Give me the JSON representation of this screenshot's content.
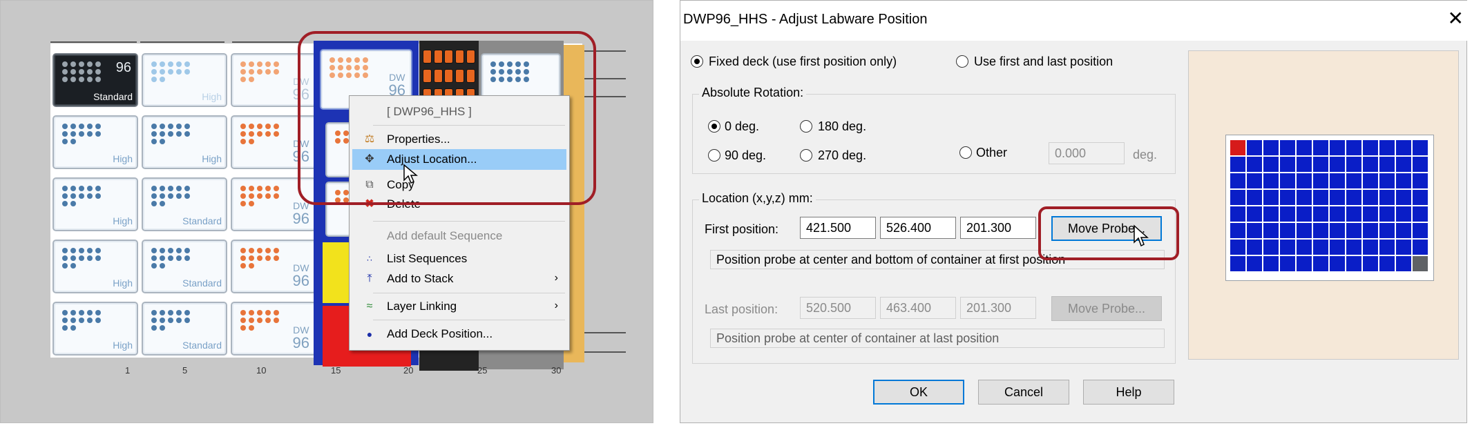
{
  "left_panel": {
    "tile_labels": {
      "standard": "Standard",
      "high": "High",
      "dw": "DW",
      "n96": "96"
    },
    "slot_numbers": [
      "1",
      "5",
      "10",
      "15",
      "20",
      "25",
      "30"
    ],
    "context_menu": {
      "header": "[ DWP96_HHS ]",
      "items": [
        {
          "label": "Properties...",
          "icon": "flask-icon"
        },
        {
          "label": "Adjust Location...",
          "icon": "move-arrows-icon",
          "highlighted": true
        },
        {
          "label": "Copy",
          "icon": "copy-icon"
        },
        {
          "label": "Delete",
          "icon": "delete-x-icon"
        },
        {
          "label": "Add default Sequence",
          "disabled": true
        },
        {
          "label": "List Sequences",
          "icon": "sequence-dots-icon"
        },
        {
          "label": "Add to Stack",
          "icon": "stack-upload-icon",
          "submenu": true
        },
        {
          "label": "Layer Linking",
          "icon": "layer-link-icon",
          "submenu": true
        },
        {
          "label": "Add Deck Position...",
          "icon": "deck-dot-icon"
        }
      ]
    }
  },
  "dialog": {
    "title": "DWP96_HHS - Adjust Labware Position",
    "mode": {
      "fixed_label": "Fixed deck (use first position only)",
      "first_last_label": "Use first and last position",
      "selected": "fixed"
    },
    "rotation": {
      "group_label": "Absolute Rotation:",
      "options": [
        "0 deg.",
        "180 deg.",
        "90 deg.",
        "270 deg."
      ],
      "other_label": "Other",
      "selected": "0 deg.",
      "other_value": "0.000",
      "unit": "deg."
    },
    "location": {
      "group_label": "Location (x,y,z) mm:",
      "first_label": "First position:",
      "first": [
        "421.500",
        "526.400",
        "201.300"
      ],
      "first_hint": "Position probe at center and bottom of container at first position",
      "last_label": "Last position:",
      "last": [
        "520.500",
        "463.400",
        "201.300"
      ],
      "last_hint": "Position probe at center of container at last position",
      "move_probe_label": "Move Probe..."
    },
    "buttons": {
      "ok": "OK",
      "cancel": "Cancel",
      "help": "Help"
    },
    "preview": {
      "rows": 8,
      "cols": 12,
      "first_color": "#d61a1a",
      "last_color": "#5f6266",
      "well_color": "#0a1ec7",
      "background": "#f5e8d8"
    }
  },
  "colors": {
    "annotation": "#a01e26",
    "carrier_blue": "#1d33b4",
    "highlight": "#99ccf7"
  }
}
